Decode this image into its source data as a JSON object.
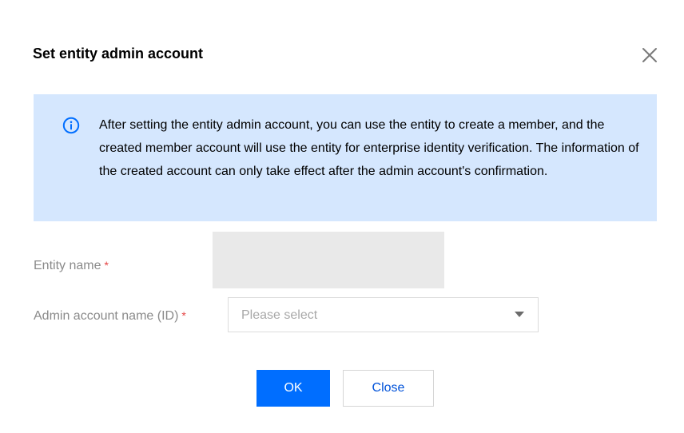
{
  "dialog": {
    "title": "Set entity admin account",
    "close_icon": "close-icon"
  },
  "notice": {
    "icon": "info-icon",
    "text": "After setting the entity admin account, you can use the entity to create a member, and the created member account will use the entity for enterprise identity verification. The information of the created account can only take effect after the admin account's confirmation."
  },
  "form": {
    "entity_name_label": "Entity name",
    "admin_account_label": "Admin account name (ID)",
    "required_mark": "*",
    "admin_account_placeholder": "Please select"
  },
  "actions": {
    "ok_label": "OK",
    "close_label": "Close"
  },
  "colors": {
    "primary": "#006eff",
    "notice_bg": "#d5e7fe",
    "required": "#e54545"
  }
}
